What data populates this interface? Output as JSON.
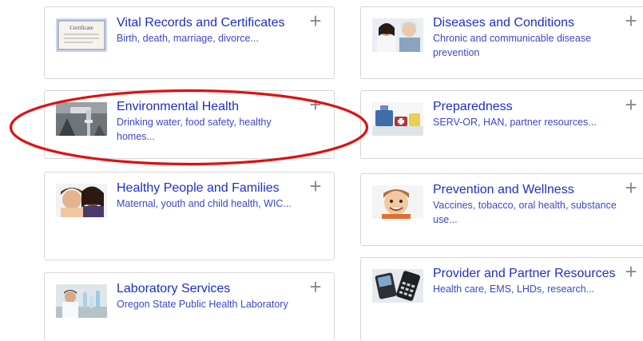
{
  "cards": [
    {
      "title": "Vital Records and Certificates",
      "desc": "Birth, death, marriage, divorce...",
      "image": "certificate-thumbnail",
      "thumb_text": "Certificate"
    },
    {
      "title": "Environmental Health",
      "desc": "Drinking water, food safety, healthy homes...",
      "image": "water-faucet-thumbnail"
    },
    {
      "title": "Healthy People and Families",
      "desc": "Maternal, youth and child health, WIC...",
      "image": "mother-child-thumbnail"
    },
    {
      "title": "Laboratory Services",
      "desc": "Oregon State Public Health Laboratory",
      "image": "lab-scientist-thumbnail"
    },
    {
      "title": "Diseases and Conditions",
      "desc": "Chronic and communicable disease prevention",
      "image": "doctor-patient-thumbnail"
    },
    {
      "title": "Preparedness",
      "desc": "SERV-OR, HAN, partner resources...",
      "image": "supplies-thumbnail"
    },
    {
      "title": "Prevention and Wellness",
      "desc": "Vaccines, tobacco, oral health, substance use...",
      "image": "smiling-child-thumbnail"
    },
    {
      "title": "Provider and Partner Resources",
      "desc": "Health care, EMS, LHDs, research...",
      "image": "phone-devices-thumbnail"
    }
  ],
  "plus_glyph": "+",
  "highlight_color": "#e01010"
}
